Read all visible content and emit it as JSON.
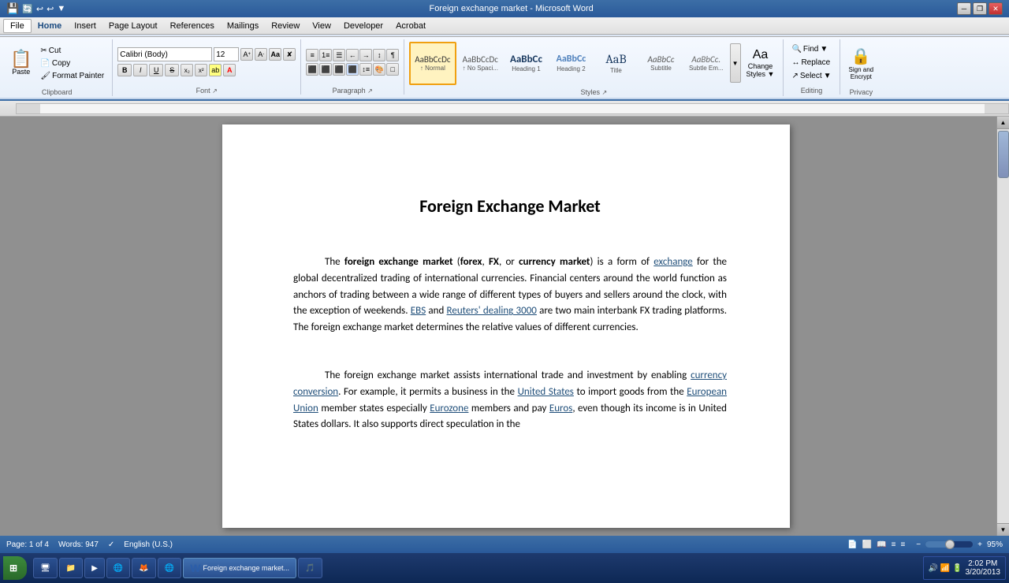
{
  "titleBar": {
    "title": "Foreign exchange market - Microsoft Word",
    "minimize": "─",
    "restore": "❐",
    "close": "✕"
  },
  "menuBar": {
    "items": [
      "File",
      "Home",
      "Insert",
      "Page Layout",
      "References",
      "Mailings",
      "Review",
      "View",
      "Developer",
      "Acrobat"
    ],
    "active": "Home"
  },
  "ribbon": {
    "clipboardGroup": {
      "label": "Clipboard",
      "paste": "Paste",
      "cut": "Cut",
      "copy": "Copy",
      "formatPainter": "Format Painter"
    },
    "fontGroup": {
      "label": "Font",
      "fontName": "Calibri (Body)",
      "fontSize": "12",
      "growIcon": "A↑",
      "shrinkIcon": "A↓",
      "clearFormatting": "A",
      "bold": "B",
      "italic": "I",
      "underline": "U",
      "strikethrough": "S",
      "subscript": "x₂",
      "superscript": "x²",
      "textHighlight": "🖊",
      "fontColor": "A"
    },
    "paragraphGroup": {
      "label": "Paragraph",
      "bullets": "≡",
      "numbering": "1.",
      "multilevel": "☰",
      "decreaseIndent": "←≡",
      "increaseIndent": "≡→",
      "sort": "↕",
      "showHide": "¶",
      "alignLeft": "≡",
      "alignCenter": "≡",
      "alignRight": "≡",
      "justify": "≡",
      "lineSpacing": "≡",
      "shading": "A",
      "borders": "□"
    },
    "stylesGroup": {
      "label": "Styles",
      "normal": {
        "preview": "AaBbCcDc",
        "label": "↑ Normal",
        "active": true
      },
      "noSpacing": {
        "preview": "AaBbCcDc",
        "label": "↑ No Spaci..."
      },
      "heading1": {
        "preview": "AaBbCc",
        "label": "Heading 1"
      },
      "heading2": {
        "preview": "AaBbCc",
        "label": "Heading 2"
      },
      "title": {
        "preview": "AaB",
        "label": "Title"
      },
      "subtitle": {
        "preview": "AaBbCc",
        "label": "Subtitle"
      },
      "subtleEm": {
        "preview": "AaBbCc.",
        "label": "Subtle Em..."
      }
    },
    "editingGroup": {
      "label": "Editing",
      "find": "Find",
      "replace": "Replace",
      "select": "Select"
    },
    "privacyGroup": {
      "label": "Privacy",
      "signEncrypt": "Sign and Encrypt"
    }
  },
  "document": {
    "title": "Foreign Exchange Market",
    "paragraph1": {
      "text": "The foreign exchange market (forex, FX, or currency market) is a form of exchange for the global decentralized trading of international currencies. Financial centers around the world function as anchors of trading between a wide range of different types of buyers and sellers around the clock, with the exception of weekends.",
      "links": [
        "exchange",
        "EBS",
        "Reuters' dealing 3000"
      ],
      "continuation": " EBS and Reuters' dealing 3000 are two main interbank FX trading platforms. The foreign exchange market determines the relative values of different currencies."
    },
    "paragraph2": {
      "text": "The foreign exchange market assists international trade and investment by enabling currency conversion. For example, it permits a business in the United States to import goods from the European Union member states especially Eurozone members and pay Euros, even though its income is in United States dollars. It also supports direct speculation in the"
    }
  },
  "statusBar": {
    "page": "Page: 1 of 4",
    "words": "Words: 947",
    "language": "English (U.S.)",
    "zoom": "95%",
    "time": "2:02 PM",
    "date": "3/20/2013"
  },
  "taskbar": {
    "start": "Start",
    "buttons": [
      {
        "icon": "🖥",
        "label": "Desktop"
      },
      {
        "icon": "📁",
        "label": "Explorer"
      },
      {
        "icon": "▶",
        "label": "Media"
      },
      {
        "icon": "🌐",
        "label": "Browser"
      },
      {
        "icon": "🦊",
        "label": "Firefox"
      },
      {
        "icon": "🌐",
        "label": "Chrome"
      },
      {
        "icon": "W",
        "label": "Microsoft Word",
        "active": true
      },
      {
        "icon": "🎵",
        "label": "Music"
      }
    ]
  }
}
